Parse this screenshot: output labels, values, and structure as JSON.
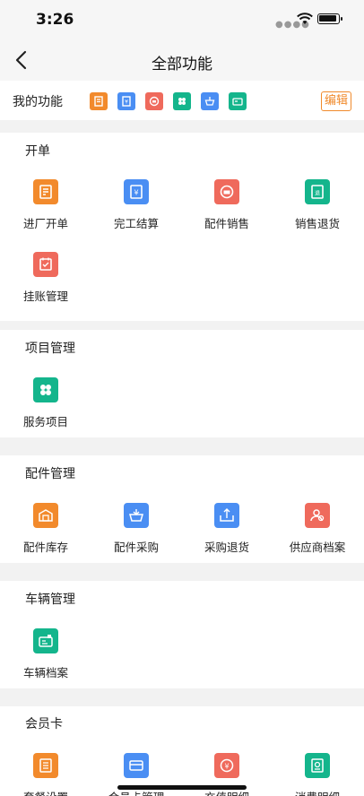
{
  "status": {
    "time": "3:26"
  },
  "nav": {
    "title": "全部功能"
  },
  "my_features": {
    "label": "我的功能",
    "edit_label": "编辑",
    "icons": [
      {
        "name": "invoice-icon",
        "color": "#f28a2c"
      },
      {
        "name": "settlement-icon",
        "color": "#4a8ef3"
      },
      {
        "name": "parts-sales-icon",
        "color": "#ef6a5c"
      },
      {
        "name": "services-icon",
        "color": "#14b58c"
      },
      {
        "name": "parts-purchase-icon",
        "color": "#4a8ef3"
      },
      {
        "name": "vehicle-file-icon",
        "color": "#14b58c"
      }
    ]
  },
  "sections": [
    {
      "title": "开单",
      "items": [
        {
          "label": "进厂开单",
          "icon": "invoice-icon",
          "color": "orange"
        },
        {
          "label": "完工结算",
          "icon": "settlement-icon",
          "color": "blue"
        },
        {
          "label": "配件销售",
          "icon": "parts-sales-icon",
          "color": "red"
        },
        {
          "label": "销售退货",
          "icon": "sales-return-icon",
          "color": "green"
        },
        {
          "label": "挂账管理",
          "icon": "credit-account-icon",
          "color": "red"
        }
      ]
    },
    {
      "title": "项目管理",
      "items": [
        {
          "label": "服务项目",
          "icon": "services-icon",
          "color": "green"
        }
      ]
    },
    {
      "title": "配件管理",
      "items": [
        {
          "label": "配件库存",
          "icon": "parts-inventory-icon",
          "color": "orange"
        },
        {
          "label": "配件采购",
          "icon": "parts-purchase-icon",
          "color": "blue"
        },
        {
          "label": "采购退货",
          "icon": "purchase-return-icon",
          "color": "blue"
        },
        {
          "label": "供应商档案",
          "icon": "supplier-file-icon",
          "color": "red"
        }
      ]
    },
    {
      "title": "车辆管理",
      "items": [
        {
          "label": "车辆档案",
          "icon": "vehicle-file-icon",
          "color": "green"
        }
      ]
    },
    {
      "title": "会员卡",
      "items": [
        {
          "label": "套餐设置",
          "icon": "package-settings-icon",
          "color": "orange"
        },
        {
          "label": "会员卡管理",
          "icon": "membership-card-icon",
          "color": "blue"
        },
        {
          "label": "充值明细",
          "icon": "recharge-detail-icon",
          "color": "red"
        },
        {
          "label": "消费明细",
          "icon": "consumption-detail-icon",
          "color": "green"
        }
      ]
    }
  ]
}
